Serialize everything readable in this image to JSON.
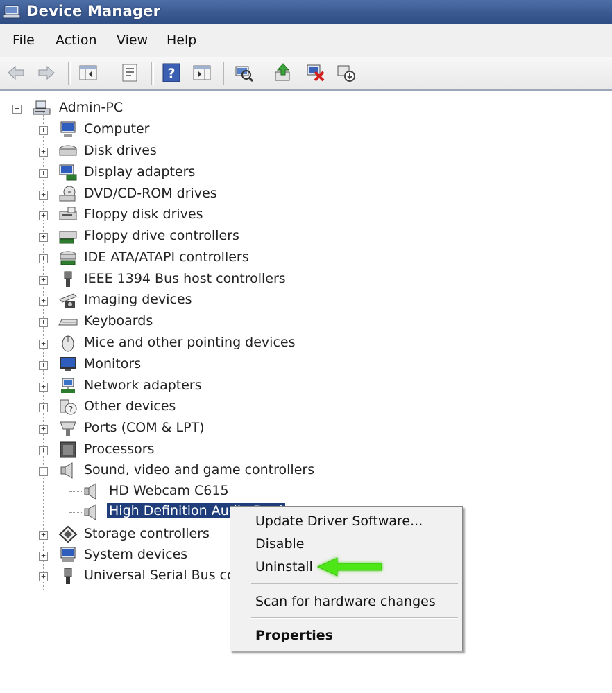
{
  "window": {
    "title": "Device Manager"
  },
  "menu": [
    "File",
    "Action",
    "View",
    "Help"
  ],
  "toolbar": {
    "buttons": [
      "back-icon",
      "forward-icon",
      "show-hide-console-tree-icon",
      "properties-icon",
      "help-icon",
      "action-pane-icon",
      "scan-hardware-icon",
      "update-driver-icon",
      "disable-device-icon",
      "uninstall-device-icon"
    ]
  },
  "tree": {
    "root": "Admin-PC",
    "categories": [
      "Computer",
      "Disk drives",
      "Display adapters",
      "DVD/CD-ROM drives",
      "Floppy disk drives",
      "Floppy drive controllers",
      "IDE ATA/ATAPI controllers",
      "IEEE 1394 Bus host controllers",
      "Imaging devices",
      "Keyboards",
      "Mice and other pointing devices",
      "Monitors",
      "Network adapters",
      "Other devices",
      "Ports (COM & LPT)",
      "Processors",
      "Sound, video and game controllers",
      "Storage controllers",
      "System devices",
      "Universal Serial Bus cor"
    ],
    "children": [
      "HD Webcam C615",
      "High Definition Audio Devi"
    ],
    "expander_plus": "+",
    "expander_minus": "−"
  },
  "context_menu": {
    "items": [
      "Update Driver Software...",
      "Disable",
      "Uninstall",
      "Scan for hardware changes",
      "Properties"
    ]
  },
  "colors": {
    "selection": "#1f3d7a",
    "arrow": "#4ee619",
    "titlebar": "#3b5a91"
  }
}
